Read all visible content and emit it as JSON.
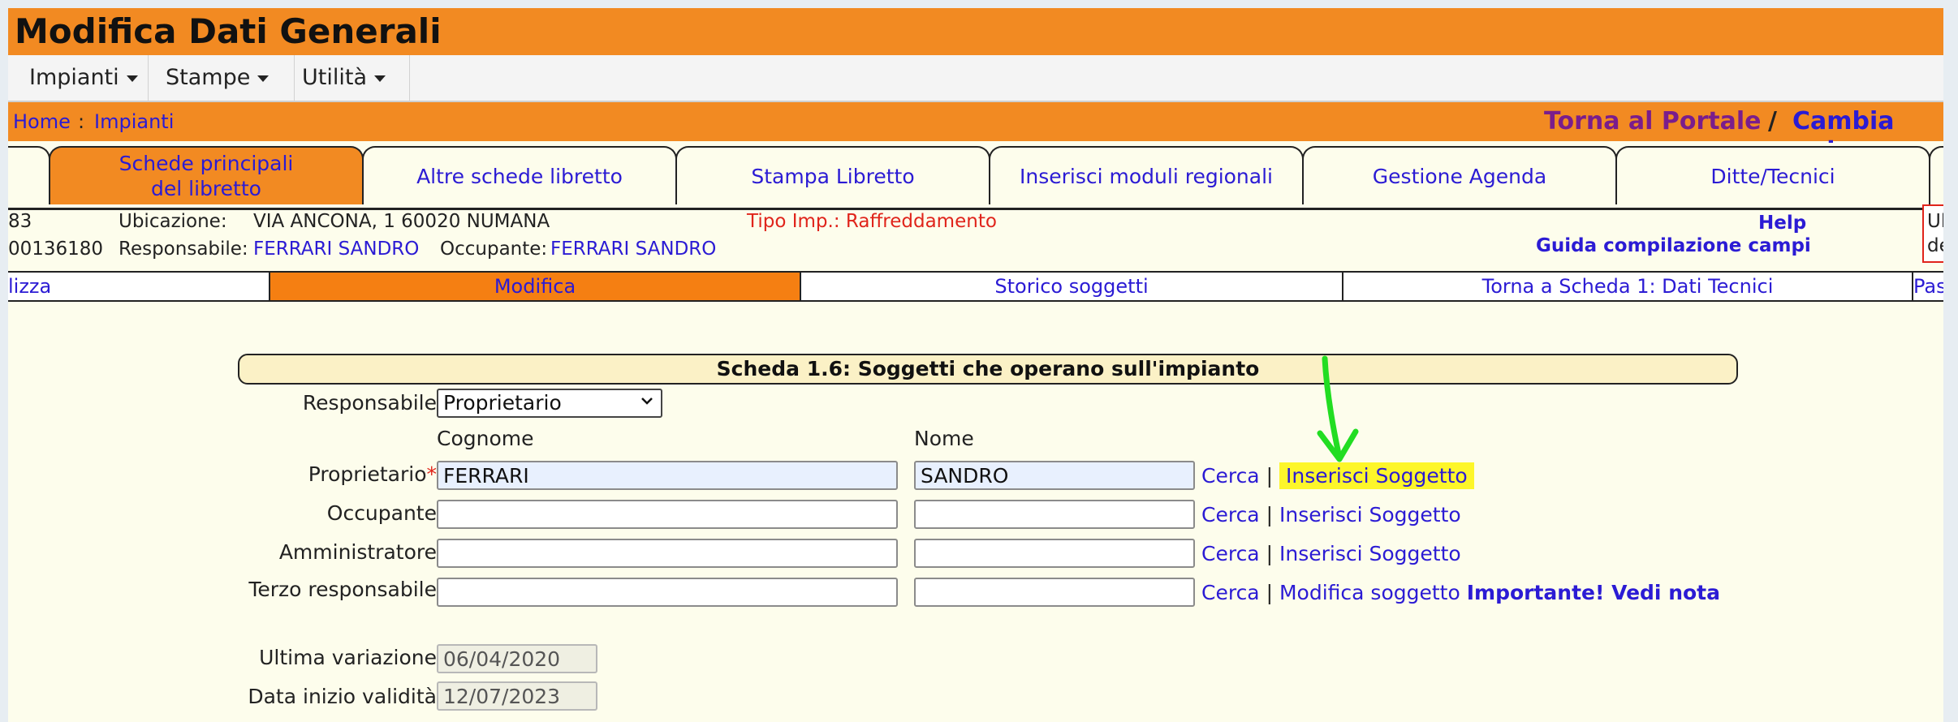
{
  "title": "Modifica Dati Generali",
  "menu": [
    {
      "label": "Impianti"
    },
    {
      "label": "Stampe"
    },
    {
      "label": "Utilità"
    }
  ],
  "breadcrumb": {
    "home": "Home",
    "separator": ":",
    "current": "Impianti"
  },
  "top_links": {
    "portale": "Torna al Portale",
    "slash": "/",
    "cambia": "Cambia ent"
  },
  "tabs": [
    {
      "label": "Schede principali\ndel libretto"
    },
    {
      "label": "Altre schede libretto"
    },
    {
      "label": "Stampa Libretto"
    },
    {
      "label": "Inserisci moduli regionali"
    },
    {
      "label": "Gestione Agenda"
    },
    {
      "label": "Ditte/Tecnici"
    }
  ],
  "info": {
    "code_partial_1": "83",
    "code_partial_2": "00136180",
    "ubicazione_label": "Ubicazione:",
    "ubicazione_value": "VIA ANCONA, 1 60020 NUMANA",
    "responsabile_label": "Responsabile:",
    "responsabile_value": "FERRARI SANDRO",
    "occupante_label": "Occupante:",
    "occupante_value": "FERRARI SANDRO",
    "tipo_imp": "Tipo Imp.: Raffreddamento",
    "help": "Help",
    "guida": "Guida compilazione campi",
    "right_partial_1": "Ul",
    "right_partial_2": "de"
  },
  "subnav": [
    {
      "label": "lizza"
    },
    {
      "label": "Modifica"
    },
    {
      "label": "Storico soggetti"
    },
    {
      "label": "Torna a Scheda 1: Dati Tecnici"
    },
    {
      "label": "Pas"
    }
  ],
  "form": {
    "header": "Scheda 1.6: Soggetti che operano sull'impianto",
    "responsabile_label": "Responsabile",
    "responsabile_value": "Proprietario",
    "col_cognome": "Cognome",
    "col_nome": "Nome",
    "rows": [
      {
        "label": "Proprietario",
        "required": "*",
        "cognome": "FERRARI",
        "nome": "SANDRO",
        "link1": "Cerca",
        "sep": "|",
        "link2": "Inserisci Soggetto",
        "note": ""
      },
      {
        "label": "Occupante",
        "required": "",
        "cognome": "",
        "nome": "",
        "link1": "Cerca",
        "sep": "|",
        "link2": "Inserisci Soggetto",
        "note": ""
      },
      {
        "label": "Amministratore",
        "required": "",
        "cognome": "",
        "nome": "",
        "link1": "Cerca",
        "sep": "|",
        "link2": "Inserisci Soggetto",
        "note": ""
      },
      {
        "label": "Terzo responsabile",
        "required": "",
        "cognome": "",
        "nome": "",
        "link1": "Cerca",
        "sep": "|",
        "link2": "Modifica soggetto",
        "note": "Importante! Vedi nota"
      }
    ],
    "ultima_variazione_label": "Ultima variazione",
    "ultima_variazione_value": "06/04/2020",
    "data_inizio_label": "Data inizio validità",
    "data_inizio_value": "12/07/2023"
  },
  "colors": {
    "accent": "#f28a22",
    "link": "#2b1bd4",
    "highlight": "#fdf62a",
    "annotation_arrow": "#22dd22",
    "required": "#e0241b"
  }
}
